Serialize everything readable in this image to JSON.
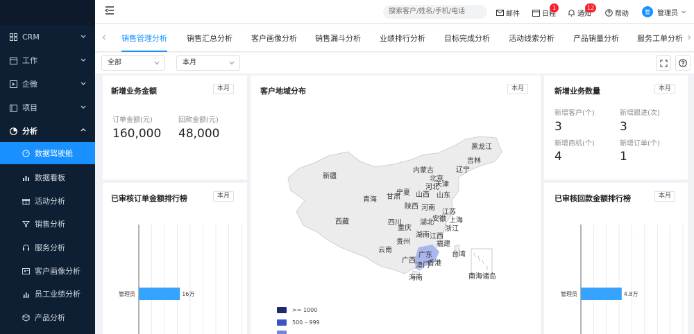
{
  "sidebar": {
    "items": [
      {
        "label": "CRM",
        "icon": "grid-icon"
      },
      {
        "label": "工作",
        "icon": "calendar-icon"
      },
      {
        "label": "企微",
        "icon": "play-square-icon"
      },
      {
        "label": "项目",
        "icon": "folder-icon"
      },
      {
        "label": "分析",
        "icon": "pie-chart-icon"
      }
    ],
    "subitems": [
      {
        "label": "数据驾驶舱",
        "icon": "dashboard-icon"
      },
      {
        "label": "数据看板",
        "icon": "bar-chart-icon"
      },
      {
        "label": "活动分析",
        "icon": "gift-icon"
      },
      {
        "label": "销售分析",
        "icon": "filter-icon"
      },
      {
        "label": "服务分析",
        "icon": "headset-icon"
      },
      {
        "label": "客户画像分析",
        "icon": "id-card-icon"
      },
      {
        "label": "员工业绩分析",
        "icon": "chart-icon"
      },
      {
        "label": "产品分析",
        "icon": "box-icon"
      }
    ]
  },
  "topbar": {
    "search_placeholder": "搜索客户/姓名/手机/电话",
    "mail": "邮件",
    "calendar": "日程",
    "calendar_badge": "1",
    "notice": "通知",
    "notice_badge": "12",
    "help": "帮助",
    "avatar_text": "管",
    "user": "管理员"
  },
  "tabs": [
    "销售管理分析",
    "销售汇总分析",
    "客户画像分析",
    "销售漏斗分析",
    "业绩排行分析",
    "目标完成分析",
    "活动线索分析",
    "产品销量分析",
    "服务工单分析"
  ],
  "filters": {
    "scope": "全部",
    "period": "本月"
  },
  "cards": {
    "new_amount": {
      "title": "新增业务金额",
      "period": "本月",
      "order_label": "订单金额(元)",
      "order_value": "160,000",
      "payment_label": "回款金额(元)",
      "payment_value": "48,000"
    },
    "region": {
      "title": "客户地域分布",
      "period": "本月"
    },
    "new_count": {
      "title": "新增业务数量",
      "period": "本月",
      "items": [
        {
          "label": "新增客户(个)",
          "value": "3"
        },
        {
          "label": "新增跟进(次)",
          "value": "3"
        },
        {
          "label": "新增商机(个)",
          "value": "4"
        },
        {
          "label": "新增订单(个)",
          "value": "1"
        }
      ]
    },
    "order_rank": {
      "title": "已审核订单金额排行榜",
      "period": "本月"
    },
    "payment_rank": {
      "title": "已审核回款金额排行榜",
      "period": "本月"
    }
  },
  "map": {
    "provinces": [
      "黑龙江",
      "吉林",
      "辽宁",
      "内蒙古",
      "新疆",
      "北京",
      "天津",
      "河北",
      "宁夏",
      "山西",
      "山东",
      "青海",
      "甘肃",
      "陕西",
      "河南",
      "江苏",
      "西藏",
      "四川",
      "湖北",
      "安徽",
      "上海",
      "重庆",
      "浙江",
      "湖南",
      "江西",
      "贵州",
      "福建",
      "云南",
      "广东",
      "台湾",
      "广西",
      "澳门",
      "香港",
      "海南",
      "南海诸岛"
    ],
    "legend": [
      {
        "label": ">= 1000",
        "color": "#1f2a6b"
      },
      {
        "label": "500 – 999",
        "color": "#3d55c4"
      },
      {
        "label": "",
        "color": "#7186d9"
      }
    ],
    "highlight_color": "#a9b7ec"
  },
  "chart_data": [
    {
      "type": "bar",
      "orientation": "horizontal",
      "categories": [
        "管理员"
      ],
      "values": [
        16
      ],
      "data_labels": [
        "16万"
      ],
      "xlim": [
        0,
        40
      ]
    },
    {
      "type": "bar",
      "orientation": "horizontal",
      "categories": [
        "管理员"
      ],
      "values": [
        4.8
      ],
      "data_labels": [
        "4.8万"
      ],
      "xlim": [
        0,
        12
      ]
    }
  ]
}
